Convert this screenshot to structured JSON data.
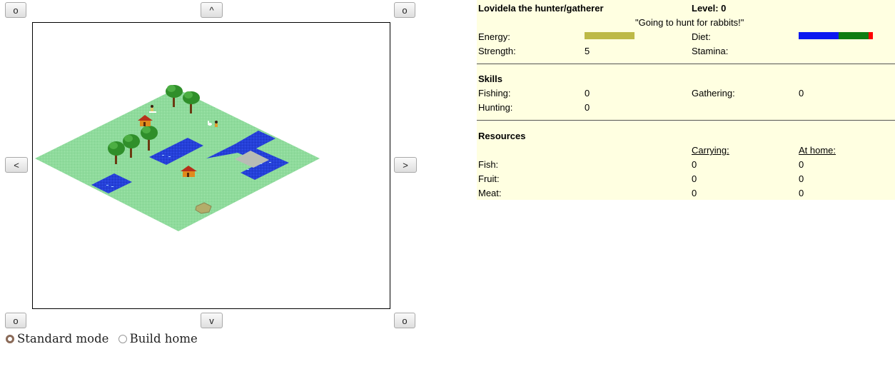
{
  "nav": {
    "up": "^",
    "down": "v",
    "left": "<",
    "right": ">",
    "corner_top_left": "o",
    "corner_top_right": "o",
    "corner_bottom_left": "o",
    "corner_bottom_right": "o"
  },
  "modes": {
    "standard": "Standard mode",
    "build": "Build home",
    "selected": "standard"
  },
  "character": {
    "name": "Lovidela the hunter/gatherer",
    "level_label": "Level: 0",
    "status": "\"Going to hunt for rabbits!\"",
    "energy_label": "Energy:",
    "energy_fraction": 0.42,
    "diet_label": "Diet:",
    "diet_segments": [
      {
        "name": "fish",
        "fraction": 0.54,
        "color": "#0a18f0"
      },
      {
        "name": "fruit",
        "fraction": 0.4,
        "color": "#0e7d12"
      },
      {
        "name": "meat",
        "fraction": 0.06,
        "color": "#ff0000"
      }
    ],
    "strength_label": "Strength:",
    "strength_value": "5",
    "stamina_label": "Stamina:",
    "stamina_value": ""
  },
  "skills": {
    "heading": "Skills",
    "fishing_label": "Fishing:",
    "fishing_value": "0",
    "gathering_label": "Gathering:",
    "gathering_value": "0",
    "hunting_label": "Hunting:",
    "hunting_value": "0"
  },
  "resources": {
    "heading": "Resources",
    "col_carrying": "Carrying:",
    "col_home": "At home:",
    "rows": [
      {
        "label": "Fish:",
        "carrying": "0",
        "home": "0"
      },
      {
        "label": "Fruit:",
        "carrying": "0",
        "home": "0"
      },
      {
        "label": "Meat:",
        "carrying": "0",
        "home": "0"
      }
    ]
  },
  "colors": {
    "grass": "#8fdb9c",
    "water": "#2540d8",
    "energy_bar": "#bdb947",
    "panel_bg": "#ffffe1"
  }
}
